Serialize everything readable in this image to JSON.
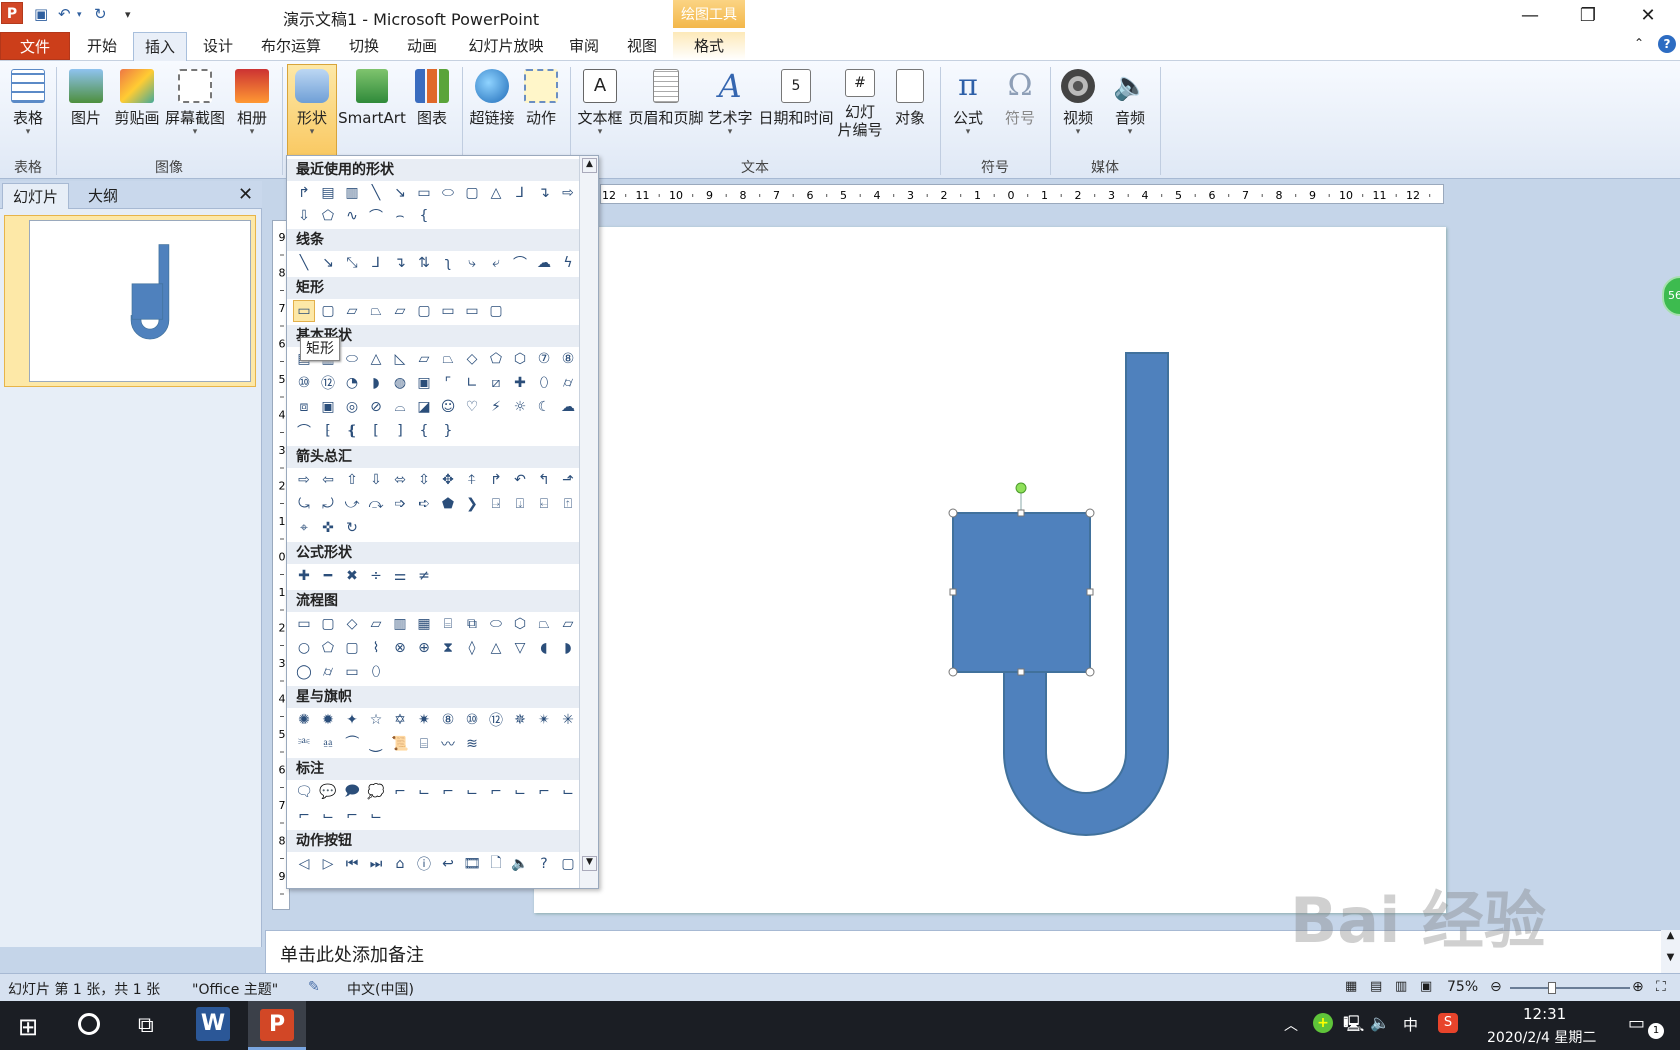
{
  "window": {
    "title": "演示文稿1 - Microsoft PowerPoint",
    "context_tab_title": "绘图工具"
  },
  "tabs": [
    "文件",
    "开始",
    "插入",
    "设计",
    "布尔运算",
    "切换",
    "动画",
    "幻灯片放映",
    "审阅",
    "视图",
    "格式"
  ],
  "ribbon": {
    "buttons": [
      "表格",
      "图片",
      "剪贴画",
      "屏幕截图",
      "相册",
      "形状",
      "SmartArt",
      "图表",
      "超链接",
      "动作",
      "文本框",
      "页眉和页脚",
      "艺术字",
      "日期和时间",
      "幻灯",
      "片编号",
      "对象",
      "公式",
      "符号",
      "视频",
      "音频"
    ],
    "groups": [
      "表格",
      "图像",
      "文本",
      "符号",
      "媒体"
    ]
  },
  "pane": {
    "tab_slides": "幻灯片",
    "tab_outline": "大纲",
    "slide_number": "1"
  },
  "gallery": {
    "sections": [
      "最近使用的形状",
      "线条",
      "矩形",
      "基本形状",
      "箭头总汇",
      "公式形状",
      "流程图",
      "星与旗帜",
      "标注",
      "动作按钮"
    ],
    "tooltip": "矩形"
  },
  "notes": {
    "placeholder": "单击此处添加备注"
  },
  "status": {
    "slide_info": "幻灯片 第 1 张，共 1 张",
    "theme": "\"Office 主题\"",
    "language": "中文(中国)",
    "zoom": "75%"
  },
  "taskbar": {
    "time": "12:31",
    "date": "2020/2/4 星期二",
    "ime": "中",
    "notify_count": "1"
  },
  "badge": "56",
  "ruler": {
    "h_ticks": [
      "12",
      "11",
      "10",
      "9",
      "8",
      "7",
      "6",
      "5",
      "4",
      "3",
      "2",
      "1",
      "0",
      "1",
      "2",
      "3",
      "4",
      "5",
      "6",
      "7",
      "8",
      "9",
      "10",
      "11",
      "12"
    ],
    "v_ticks": [
      "9",
      "8",
      "7",
      "6",
      "5",
      "4",
      "3",
      "2",
      "1",
      "0",
      "1",
      "2",
      "3",
      "4",
      "5",
      "6",
      "7",
      "8",
      "9"
    ]
  },
  "colors": {
    "shape_fill": "#4f81bd",
    "shape_stroke": "#41719c",
    "accent": "#d24726"
  }
}
